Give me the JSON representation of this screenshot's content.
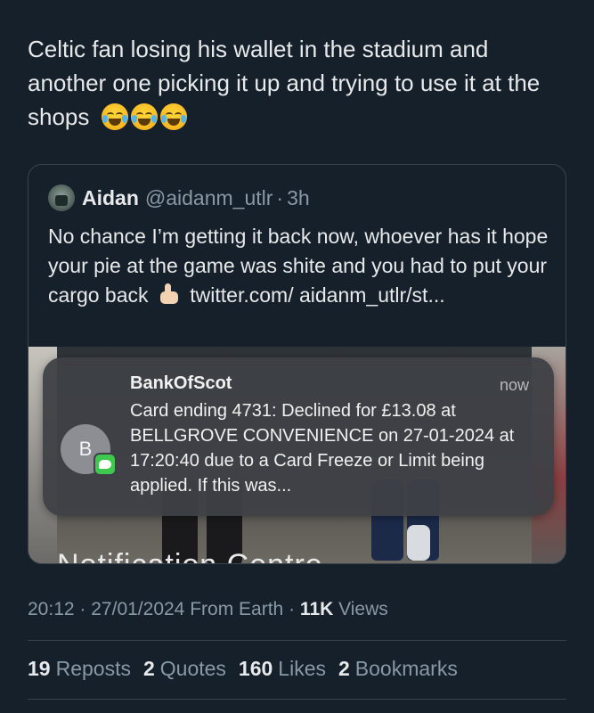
{
  "tweet": {
    "text": "Celtic fan losing his wallet in the stadium and another one picking it up and trying to use it at the shops"
  },
  "emojis": [
    "face-with-tears-of-joy-icon",
    "face-with-tears-of-joy-icon",
    "face-with-tears-of-joy-icon"
  ],
  "quoted_tweet": {
    "author_name": "Aidan",
    "handle": "@aidanm_utlr",
    "separator": "·",
    "time": "3h",
    "text_before_emoji": "No chance I’m getting it back now, whoever has it hope your pie at the game was shite and you had to put your cargo back",
    "text_after_emoji": "twitter.com/ aidanm_utlr/st..."
  },
  "notification": {
    "avatar_letter": "B",
    "sender": "BankOfScot",
    "time": "now",
    "body": "Card ending 4731: Declined for £13.08 at BELLGROVE CONVENIENCE on 27-01-2024 at 17:20:40 due to a Card Freeze or Limit being applied. If this was...",
    "partial_text_below": "Notification Centre"
  },
  "meta": {
    "time": "20:12",
    "date": "27/01/2024",
    "source": "From Earth",
    "separator": "·",
    "views_count": "11K",
    "views_label": "Views"
  },
  "stats": {
    "reposts_count": "19",
    "reposts_label": "Reposts",
    "quotes_count": "2",
    "quotes_label": "Quotes",
    "likes_count": "160",
    "likes_label": "Likes",
    "bookmarks_count": "2",
    "bookmarks_label": "Bookmarks"
  },
  "colors": {
    "background": "#15202b",
    "text_primary": "#e7e9ea",
    "text_secondary": "#8b98a5",
    "border": "#38444d",
    "imessage_badge": "#3ec84e"
  }
}
